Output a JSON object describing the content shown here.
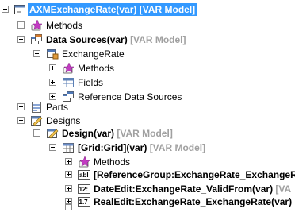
{
  "tree": {
    "root": {
      "name": "AXMExchangeRate(var)",
      "meta": "[VAR Model]"
    },
    "methods": "Methods",
    "data_sources": {
      "name": "Data Sources(var)",
      "meta": "[VAR Model]"
    },
    "exchange_rate": "ExchangeRate",
    "ds_methods": "Methods",
    "fields": "Fields",
    "ref_ds": "Reference Data Sources",
    "parts": "Parts",
    "designs": "Designs",
    "design": {
      "name": "Design(var)",
      "meta": "[VAR Model]"
    },
    "grid": {
      "name": "[Grid:Grid](var)",
      "meta": "[VAR Model]"
    },
    "grid_methods": "Methods",
    "ref_group": "[ReferenceGroup:ExchangeRate_ExchangeRa",
    "date_edit": "DateEdit:ExchangeRate_ValidFrom(var)",
    "date_edit_meta": "[VA",
    "real_edit": "RealEdit:ExchangeRate_ExchangeRate(var)"
  },
  "icons": {
    "root": "form-icon",
    "methods": "methods-icon",
    "data_sources": "data-sources-icon",
    "fields": "fields-icon",
    "ref_ds": "reference-data-sources-icon",
    "parts": "parts-icon",
    "designs": "designs-icon",
    "grid": "grid-icon",
    "string": "string-control-icon",
    "date": "date-control-icon",
    "real": "real-control-icon"
  },
  "colors": {
    "selection": "#3399ff",
    "meta_text": "#a0a0a0"
  }
}
